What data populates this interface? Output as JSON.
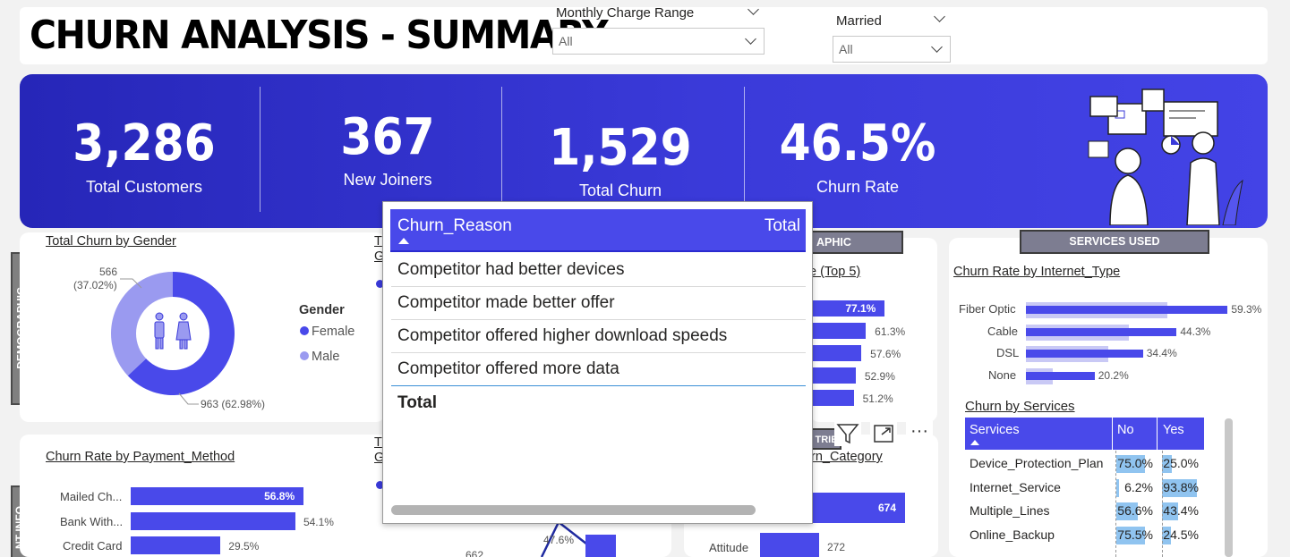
{
  "header": {
    "title": "CHURN ANALYSIS - SUMMARY",
    "slicers": [
      {
        "label": "Monthly Charge Range",
        "value": "All"
      },
      {
        "label": "Married",
        "value": "All"
      }
    ]
  },
  "kpis": [
    {
      "value": "3,286",
      "label": "Total Customers"
    },
    {
      "value": "367",
      "label": "New Joiners"
    },
    {
      "value": "1,529",
      "label": "Total Churn"
    },
    {
      "value": "46.5%",
      "label": "Churn Rate"
    }
  ],
  "side_tabs": {
    "demographic": "DEMOGRAPHIC",
    "account_info": "NT INFO"
  },
  "gender_chart": {
    "title": "Total Churn by Gender",
    "legend_title": "Gender",
    "legend": [
      "Female",
      "Male"
    ],
    "male_label_value": "566",
    "male_label_pct": "(37.02%)",
    "female_label": "963 (62.98%)",
    "slices": [
      {
        "name": "Female",
        "value": 963
      },
      {
        "name": "Male",
        "value": 566
      }
    ],
    "colors": {
      "Female": "#4949ea",
      "Male": "#9a9af0"
    }
  },
  "partial_titles": {
    "t1": "T",
    "g1": "G",
    "t2": "T",
    "g2": "G"
  },
  "demographic_btn": "APHIC",
  "age_chart": {
    "title_fragment": "e (Top 5)",
    "values": [
      "77.1%",
      "61.3%",
      "57.6%",
      "52.9%",
      "51.2%"
    ],
    "numbers": [
      77.1,
      61.3,
      57.6,
      52.9,
      51.2
    ]
  },
  "services_btn": "SERVICES USED",
  "internet_chart": {
    "title": "Churn Rate by Internet_Type",
    "categories": [
      "Fiber Optic",
      "Cable",
      "DSL",
      "None"
    ],
    "values": [
      59.3,
      44.3,
      34.4,
      20.2
    ],
    "labels": [
      "59.3%",
      "44.3%",
      "34.4%",
      "20.2%"
    ]
  },
  "services_table": {
    "title": "Churn by Services",
    "columns": [
      "Services",
      "No",
      "Yes"
    ],
    "rows": [
      {
        "service": "Device_Protection_Plan",
        "no": "75.0%",
        "yes": "25.0%",
        "no_v": 75.0,
        "yes_v": 25.0
      },
      {
        "service": "Internet_Service",
        "no": "6.2%",
        "yes": "93.8%",
        "no_v": 6.2,
        "yes_v": 93.8
      },
      {
        "service": "Multiple_Lines",
        "no": "56.6%",
        "yes": "43.4%",
        "no_v": 56.6,
        "yes_v": 43.4
      },
      {
        "service": "Online_Backup",
        "no": "75.5%",
        "yes": "24.5%",
        "no_v": 75.5,
        "yes_v": 24.5
      }
    ]
  },
  "payment_chart": {
    "title": "Churn Rate by Payment_Method",
    "categories": [
      "Mailed Ch...",
      "Bank With...",
      "Credit Card"
    ],
    "values": [
      56.8,
      54.1,
      29.5
    ],
    "labels": [
      "56.8%",
      "54.1%",
      "29.5%"
    ]
  },
  "middle_fragments": {
    "pct": "47.6%",
    "num": "662"
  },
  "churn_category": {
    "title_fragment": "rn_Category",
    "header_fragment": "TRIE",
    "categories": [
      "",
      "Attitude"
    ],
    "values": [
      674,
      272
    ],
    "labels": [
      "674",
      "272"
    ]
  },
  "tooltip": {
    "col1": "Churn_Reason",
    "col2": "Total",
    "rows": [
      "Competitor had better devices",
      "Competitor made better offer",
      "Competitor offered higher download speeds",
      "Competitor offered more data"
    ],
    "total_label": "Total"
  },
  "visual_toolbar": {
    "more": "···"
  }
}
